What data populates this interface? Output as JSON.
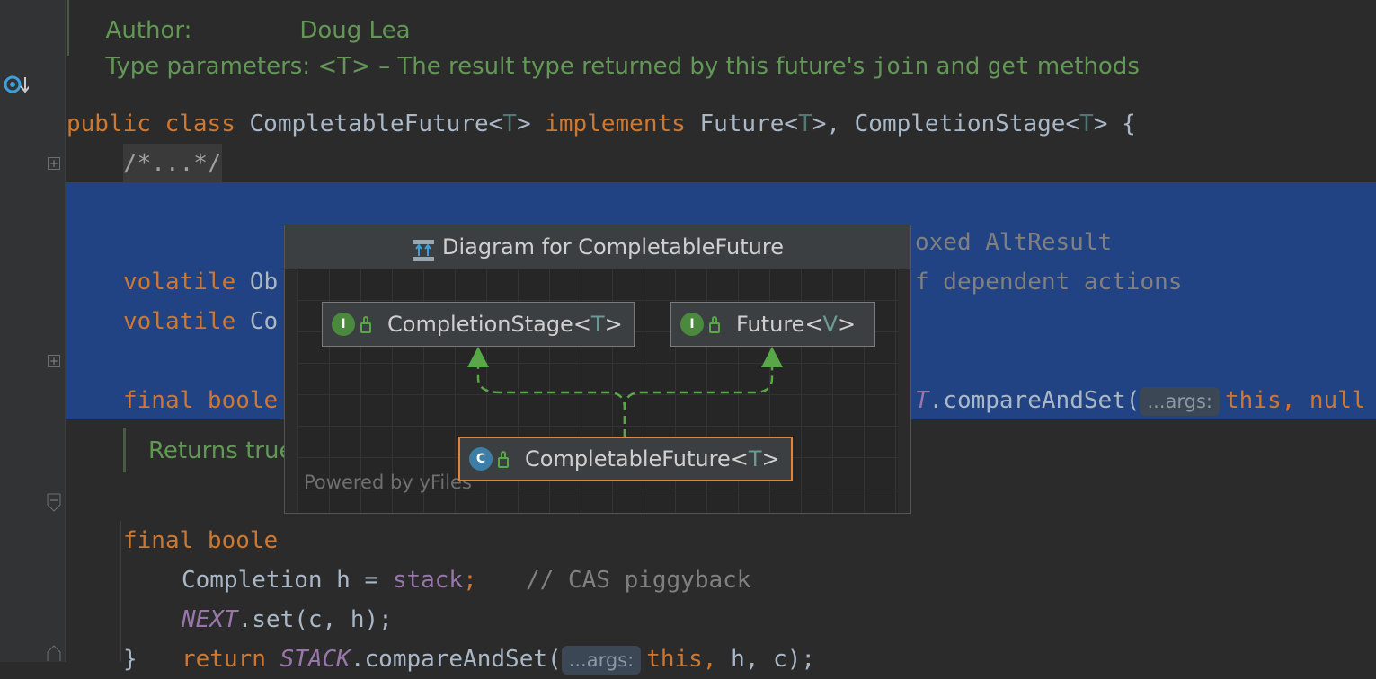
{
  "editor": {
    "doc_author_label": "Author:",
    "doc_author_value": "Doug Lea",
    "doc_type_params_prefix": "Type parameters: <T> – The result type returned by this future's ",
    "doc_join": "join",
    "doc_and": " and ",
    "doc_get": "get",
    "doc_methods": " methods",
    "class_line": {
      "public": "public",
      "class": "class",
      "name": " CompletableFuture<",
      "T": "T",
      "close": "> ",
      "implements": "implements",
      "future": " Future<",
      "close2": ">, CompletionStage<",
      "close3": "> {"
    },
    "folded_comment": "/*...*/",
    "line_volatile1_kw": "volatile",
    "line_volatile1_text": " Ob",
    "line_volatile1_tail": "oxed AltResult",
    "line_volatile2_kw": "volatile",
    "line_volatile2_text": " Co",
    "line_volatile2_tail": "f dependent actions",
    "line_final1_kw": "final boole",
    "line_final1_tail_field": "T",
    "line_final1_tail_method": ".compareAndSet(",
    "line_final1_hint": "...args:",
    "line_final1_end": "this, null",
    "doc_returns": "Returns true",
    "line_final2_kw": "final boole",
    "line_completion": "Completion h = ",
    "line_completion_field": "stack",
    "line_completion_end": ";",
    "line_next_field": "NEXT",
    "line_next_call": ".set(c, h);",
    "line_next_comment": "// CAS piggyback",
    "line_return_kw": "return ",
    "line_return_field": "STACK",
    "line_return_call": ".compareAndSet(",
    "line_return_hint": "...args:",
    "line_return_this": "this, ",
    "line_return_end": "h, c);",
    "closing_brace": "}"
  },
  "popup": {
    "title": "Diagram for CompletableFuture",
    "nodes": [
      {
        "name": "CompletionStage",
        "tparam": "T",
        "kind": "I"
      },
      {
        "name": "Future",
        "tparam": "V",
        "kind": "I"
      },
      {
        "name": "CompletableFuture",
        "tparam": "T",
        "kind": "C"
      }
    ],
    "powered_by": "Powered by yFiles"
  },
  "colors": {
    "selection": "#214283",
    "keyword": "#cc7832",
    "doc": "#629755",
    "field": "#9876aa",
    "accent_border": "#e0853a"
  }
}
